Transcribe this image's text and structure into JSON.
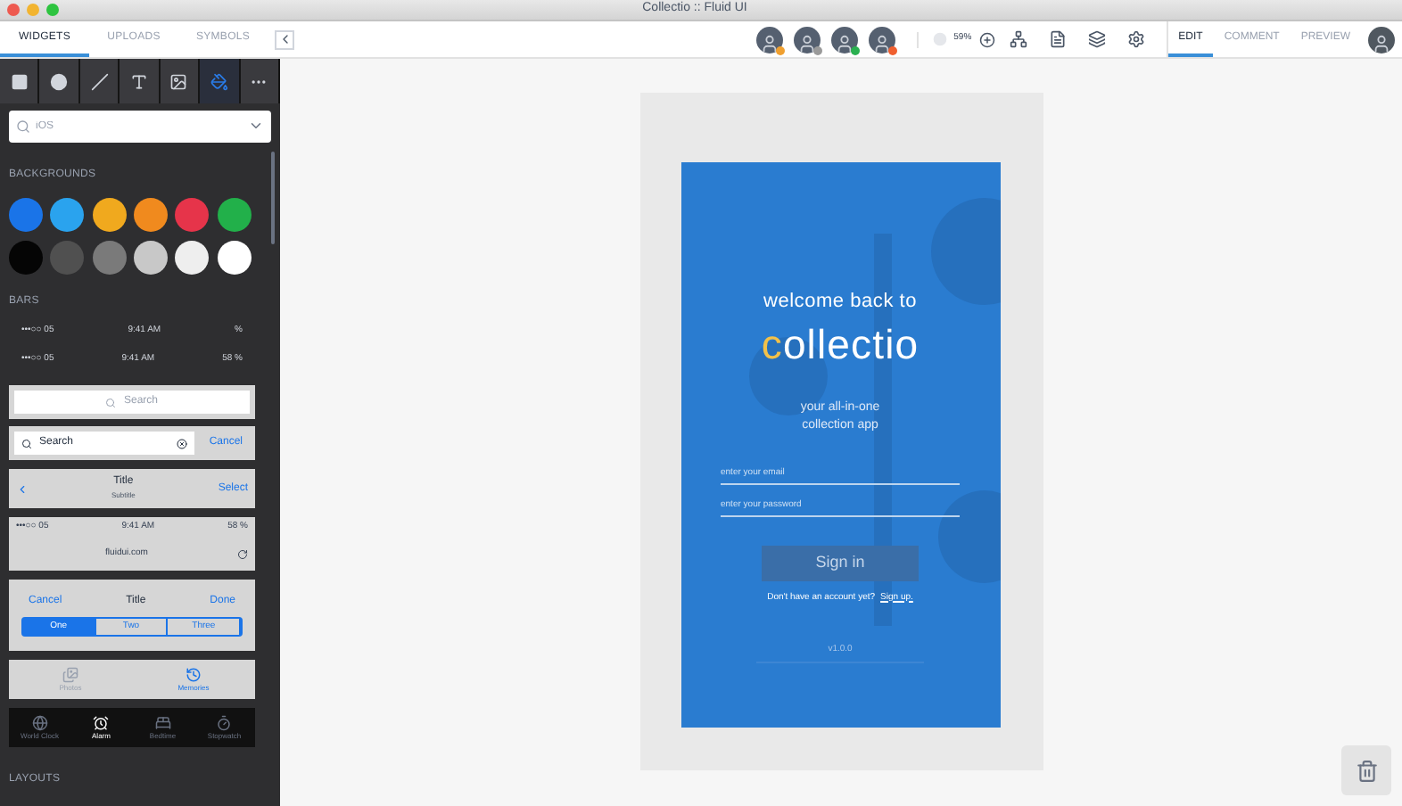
{
  "window": {
    "title": "Collectio :: Fluid UI"
  },
  "panel_tabs": [
    {
      "label": "WIDGETS",
      "selected": true
    },
    {
      "label": "UPLOADS",
      "selected": false
    },
    {
      "label": "SYMBOLS",
      "selected": false
    }
  ],
  "collaborators": [
    {
      "color": "#f0a030"
    },
    {
      "color": "#9a9a9a"
    },
    {
      "color": "#2ab050"
    },
    {
      "color": "#f06030"
    }
  ],
  "zoom": "59%",
  "mode_tabs": [
    {
      "label": "EDIT",
      "selected": true
    },
    {
      "label": "COMMENT",
      "selected": false
    },
    {
      "label": "PREVIEW",
      "selected": false
    }
  ],
  "tools": [
    {
      "kind": "rectangle",
      "selected": false
    },
    {
      "kind": "circle",
      "selected": false
    },
    {
      "kind": "line",
      "selected": false
    },
    {
      "kind": "text",
      "selected": false
    },
    {
      "kind": "image",
      "selected": false
    },
    {
      "kind": "fill",
      "selected": true
    },
    {
      "kind": "more",
      "selected": false
    }
  ],
  "library_search": {
    "placeholder": "iOS"
  },
  "backgrounds": {
    "label": "BACKGROUNDS",
    "swatches": [
      {
        "color": "#1a74e8"
      },
      {
        "color": "#2aa3ee"
      },
      {
        "color": "#f0a91e"
      },
      {
        "color": "#f08a1e"
      },
      {
        "color": "#e6344a"
      },
      {
        "color": "#22b04a"
      },
      {
        "color": "#050505"
      },
      {
        "color": "#505050"
      },
      {
        "color": "#7a7a7a"
      },
      {
        "color": "#c8c8c8"
      },
      {
        "color": "#eeeeee"
      },
      {
        "color": "#ffffff"
      }
    ]
  },
  "bars": {
    "label": "BARS",
    "widgets": [
      {
        "kind": "status_bar",
        "signal": "•••○○ 05",
        "time": "9:41 AM",
        "battery": "% "
      },
      {
        "kind": "status_bar",
        "signal": "•••○○ 05",
        "time": "9:41 AM",
        "battery": "58 %"
      },
      {
        "kind": "search_bar",
        "placeholder": "Search"
      },
      {
        "kind": "search_cancel",
        "value": "Search",
        "action": "Cancel"
      },
      {
        "kind": "nav_bar",
        "title": "Title",
        "subtitle": "Subtitle",
        "action": "Select"
      },
      {
        "kind": "browser_bar",
        "signal": "•••○○ 05",
        "time": "9:41 AM",
        "battery": "58 %",
        "url": "fluidui.com"
      },
      {
        "kind": "segmented_nav",
        "left": "Cancel",
        "title": "Title",
        "right": "Done",
        "segments": [
          {
            "label": "One",
            "selected": true
          },
          {
            "label": "Two",
            "selected": false
          },
          {
            "label": "Three",
            "selected": false
          }
        ]
      },
      {
        "kind": "tab_bar",
        "items": [
          {
            "label": "Photos",
            "selected": false
          },
          {
            "label": "Memories",
            "selected": true
          }
        ]
      },
      {
        "kind": "dark_tab_bar",
        "items": [
          {
            "label": "World Clock",
            "selected": false
          },
          {
            "label": "Alarm",
            "selected": true
          },
          {
            "label": "Bedtime",
            "selected": false
          },
          {
            "label": "Stopwatch",
            "selected": false
          }
        ]
      }
    ]
  },
  "layouts": {
    "label": "LAYOUTS"
  },
  "screen": {
    "greeting": "welcome back to",
    "logo_initial": "c",
    "logo_rest": "ollectio",
    "tagline": [
      "your all-in-one",
      "collection app"
    ],
    "email": {
      "placeholder": "enter your email"
    },
    "password": {
      "placeholder": "enter your password"
    },
    "sign_in": "Sign in",
    "signup_prompt": "Don't have an account yet?",
    "signup_link": "Sign up.",
    "version": "v1.0.0"
  }
}
